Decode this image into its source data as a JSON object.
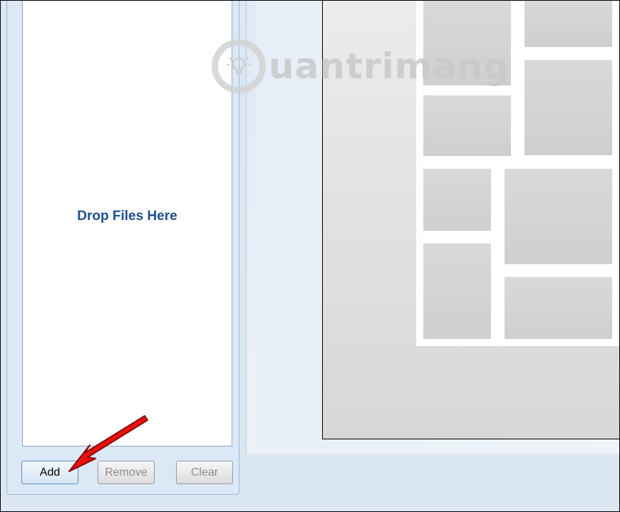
{
  "drop_zone": {
    "label": "Drop Files Here"
  },
  "buttons": {
    "add": "Add",
    "remove": "Remove",
    "clear": "Clear"
  },
  "watermark": {
    "text": "uantrimang"
  },
  "colors": {
    "drop_label": "#1f4f8f",
    "annotation_arrow": "#e8110f",
    "panel_bg": "#dce8f5"
  },
  "icons": {
    "watermark_logo": "lightbulb-icon",
    "annotation": "red-arrow-icon"
  }
}
